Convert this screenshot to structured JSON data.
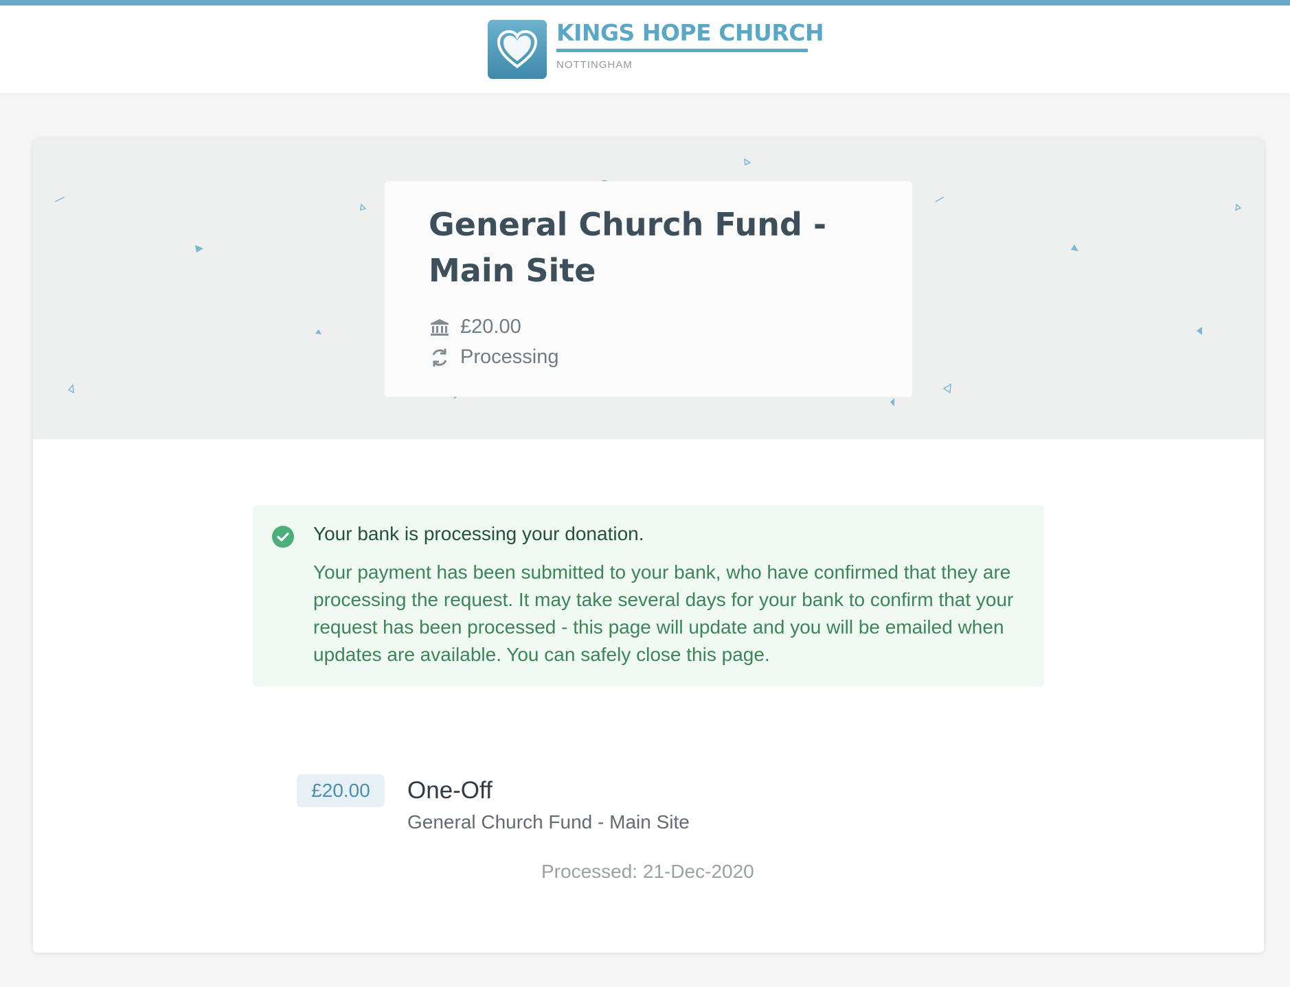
{
  "colors": {
    "brand": "#5aa8c6",
    "top_bar": "#6aa9c7",
    "success": "#4caf7a",
    "success_text": "#3b8558"
  },
  "header": {
    "logo_icon": "heart-icon",
    "org_name": "KINGS HOPE CHURCH",
    "org_location": "NOTTINGHAM"
  },
  "summary": {
    "title": "General Church Fund - Main Site",
    "amount": "£20.00",
    "amount_icon": "bank-icon",
    "status": "Processing",
    "status_icon": "refresh-icon"
  },
  "alert": {
    "icon": "check-circle-icon",
    "heading": "Your bank is processing your donation.",
    "body": "Your payment has been submitted to your bank, who have confirmed that they are processing the request. It may take several days for your bank to confirm that your request has been processed - this page will update and you will be emailed when updates are available. You can safely close this page."
  },
  "donation": {
    "amount": "£20.00",
    "frequency": "One-Off",
    "fund": "General Church Fund - Main Site",
    "processed_label": "Processed:",
    "processed_date": "21-Dec-2020"
  }
}
